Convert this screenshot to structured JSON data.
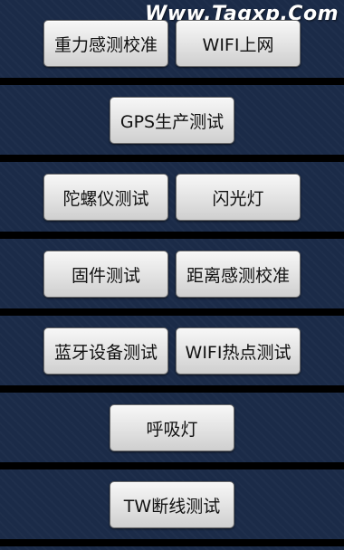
{
  "watermark": "Www.Tagxp.Com",
  "buttons": {
    "gravity_calibration": "重力感测校准",
    "wifi_internet": "WIFI上网",
    "gps_test": "GPS生产测试",
    "gyroscope_test": "陀螺仪测试",
    "flashlight": "闪光灯",
    "firmware_test": "固件测试",
    "proximity_calibration": "距离感测校准",
    "bluetooth_test": "蓝牙设备测试",
    "wifi_hotspot_test": "WIFI热点测试",
    "breathing_light": "呼吸灯",
    "tw_disconnect_test": "TW断线测试"
  },
  "colors": {
    "background": "#1b2b48",
    "separator": "#000000",
    "button_face": "#e6e6e6",
    "button_text": "#111111"
  }
}
